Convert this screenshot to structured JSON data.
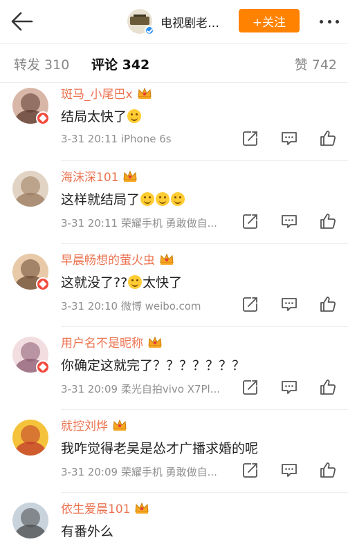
{
  "header": {
    "account_name": "电视剧老…",
    "follow_label": "+关注",
    "verified": true
  },
  "tabs": [
    {
      "label": "转发 310",
      "active": false
    },
    {
      "label": "评论 342",
      "active": true
    },
    {
      "label": "赞 742",
      "active": false
    }
  ],
  "comments": [
    {
      "username": "斑马_小尾巴x",
      "text": "结局太快了",
      "emoji": [
        "laugh-cry"
      ],
      "time": "3-31 20:11",
      "source": "iPhone 6s",
      "badge": true,
      "avatar_colors": [
        "#d9b7a8",
        "#5a3a2e"
      ]
    },
    {
      "username": "海沫深101",
      "text": "这样就结局了",
      "emoji": [
        "grin",
        "grin",
        "grin"
      ],
      "time": "3-31 20:11",
      "source": "荣耀手机 勇敢做自...",
      "badge": false,
      "avatar_colors": [
        "#e2d4c4",
        "#9a7a5e"
      ]
    },
    {
      "username": "早晨畅想的萤火虫",
      "text_before": "这就没了??",
      "text_after": "太快了",
      "emoji": [
        "laugh-cry"
      ],
      "time": "3-31 20:10",
      "source": "微博 weibo.com",
      "badge": true,
      "avatar_colors": [
        "#e8c9a8",
        "#6b4b33"
      ]
    },
    {
      "username": "用户名不是昵称",
      "text": "你确定这就完了？？？？？？？",
      "emoji": [],
      "time": "3-31 20:09",
      "source": "柔光自拍vivo X7Pl...",
      "badge": true,
      "avatar_colors": [
        "#f2dde0",
        "#8a5870"
      ]
    },
    {
      "username": "就控刘烨",
      "text": "我咋觉得老吴是怂才广播求婚的呢",
      "emoji": [],
      "time": "3-31 20:09",
      "source": "荣耀手机 勇敢做自...",
      "badge": false,
      "avatar_colors": [
        "#f5c33b",
        "#c0392b"
      ]
    },
    {
      "username": "依生爱晨101",
      "text": "有番外么",
      "emoji": [],
      "time": "",
      "source": "",
      "badge": false,
      "avatar_colors": [
        "#c8d3dc",
        "#4a4a4a"
      ]
    }
  ],
  "colors": {
    "accent": "#ff8200",
    "username": "#eb7350",
    "crown": "#f5a623",
    "verified": "#2c8ff0",
    "badge": "#f24a3d"
  },
  "icons": [
    "back-arrow-icon",
    "more-icon",
    "crown-icon",
    "repost-icon",
    "comment-icon",
    "like-icon"
  ]
}
